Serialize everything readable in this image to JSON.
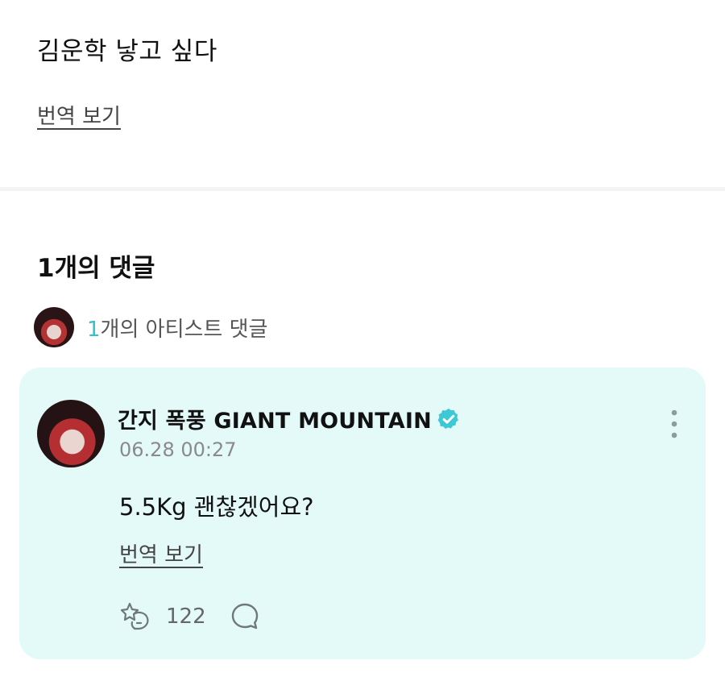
{
  "post": {
    "text": "김운학 낳고 싶다",
    "translate_label": "번역 보기"
  },
  "comments_section": {
    "count_label": "1개의 댓글",
    "artist_comments": {
      "count": "1",
      "label_suffix": "개의 아티스트 댓글"
    }
  },
  "comment": {
    "author": "간지 폭풍 GIANT MOUNTAIN",
    "verified": true,
    "timestamp": "06.28 00:27",
    "text": "5.5Kg 괜찮겠어요?",
    "translate_label": "번역 보기",
    "like_count": "122"
  },
  "colors": {
    "accent": "#2fc4cc",
    "card_background": "#e3faf8",
    "verified_badge": "#3cc8d4"
  },
  "icons": {
    "verified": "verified-badge-icon",
    "more": "more-vertical-icon",
    "like": "cheer-like-icon",
    "reply": "comment-bubble-icon"
  }
}
